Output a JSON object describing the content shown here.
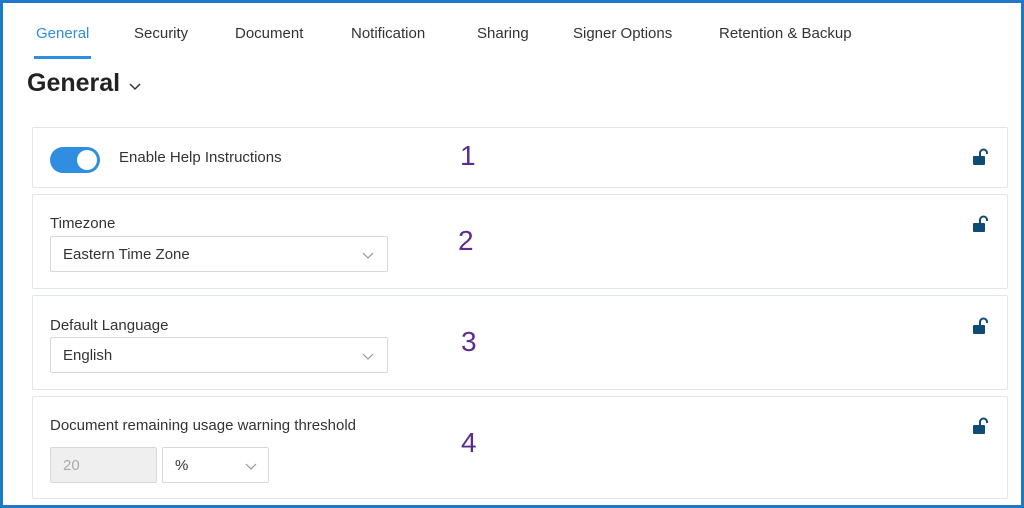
{
  "tabs": [
    {
      "label": "General",
      "active": true
    },
    {
      "label": "Security",
      "active": false
    },
    {
      "label": "Document",
      "active": false
    },
    {
      "label": "Notification",
      "active": false
    },
    {
      "label": "Sharing",
      "active": false
    },
    {
      "label": "Signer Options",
      "active": false
    },
    {
      "label": "Retention & Backup",
      "active": false
    }
  ],
  "heading": {
    "title": "General",
    "icon": "chevron-down-icon"
  },
  "help": {
    "label": "Enable Help Instructions",
    "enabled": true,
    "annotation": "1"
  },
  "timezone": {
    "label": "Timezone",
    "value": "Eastern Time Zone",
    "annotation": "2"
  },
  "language": {
    "label": "Default Language",
    "value": "English",
    "annotation": "3"
  },
  "threshold": {
    "label": "Document remaining usage warning threshold",
    "value": "20",
    "unit": "%",
    "annotation": "4"
  },
  "colors": {
    "accent": "#2f8ee0",
    "frame": "#1f78c8",
    "annotation": "#5c2d91",
    "lock": "#0f4c75"
  }
}
